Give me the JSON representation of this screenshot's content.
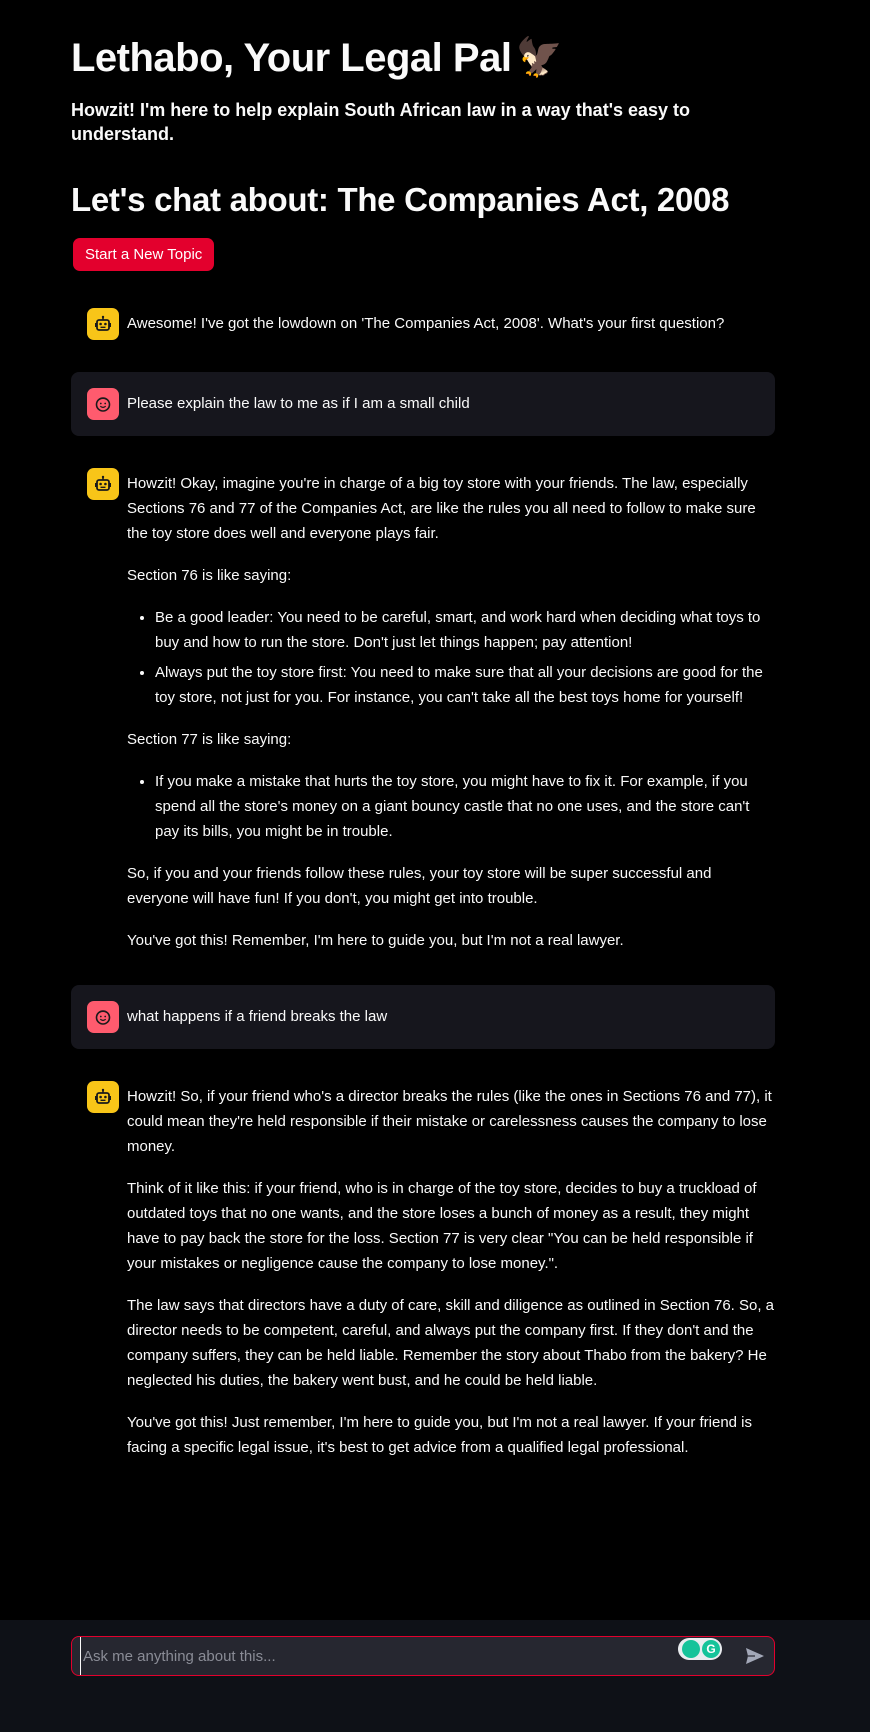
{
  "header": {
    "title": "Lethabo, Your Legal Pal",
    "title_emoji": "🦅",
    "subtitle": "Howzit! I'm here to help explain South African law in a way that's easy to understand.",
    "topic_heading": "Let's chat about: The Companies Act, 2008",
    "new_topic_label": "Start a New Topic"
  },
  "messages": {
    "m1": {
      "role": "assistant",
      "text": "Awesome! I've got the lowdown on 'The Companies Act, 2008'. What's your first question?"
    },
    "m2": {
      "role": "user",
      "text": "Please explain the law to me as if I am a small child"
    },
    "m3": {
      "role": "assistant",
      "p1": "Howzit! Okay, imagine you're in charge of a big toy store with your friends. The law, especially Sections 76 and 77 of the Companies Act, are like the rules you all need to follow to make sure the toy store does well and everyone plays fair.",
      "p2": "Section 76 is like saying:",
      "b1": "Be a good leader: You need to be careful, smart, and work hard when deciding what toys to buy and how to run the store. Don't just let things happen; pay attention!",
      "b2": "Always put the toy store first: You need to make sure that all your decisions are good for the toy store, not just for you. For instance, you can't take all the best toys home for yourself!",
      "p3": "Section 77 is like saying:",
      "b3": "If you make a mistake that hurts the toy store, you might have to fix it. For example, if you spend all the store's money on a giant bouncy castle that no one uses, and the store can't pay its bills, you might be in trouble.",
      "p4": "So, if you and your friends follow these rules, your toy store will be super successful and everyone will have fun! If you don't, you might get into trouble.",
      "p5": "You've got this! Remember, I'm here to guide you, but I'm not a real lawyer."
    },
    "m4": {
      "role": "user",
      "text": "what happens if a friend breaks the law"
    },
    "m5": {
      "role": "assistant",
      "p1": "Howzit! So, if your friend who's a director breaks the rules (like the ones in Sections 76 and 77), it could mean they're held responsible if their mistake or carelessness causes the company to lose money.",
      "p2": "Think of it like this: if your friend, who is in charge of the toy store, decides to buy a truckload of outdated toys that no one wants, and the store loses a bunch of money as a result, they might have to pay back the store for the loss. Section 77 is very clear \"You can be held responsible if your mistakes or negligence cause the company to lose money.\".",
      "p3": "The law says that directors have a duty of care, skill and diligence as outlined in Section 76. So, a director needs to be competent, careful, and always put the company first. If they don't and the company suffers, they can be held liable. Remember the story about Thabo from the bakery? He neglected his duties, the bakery went bust, and he could be held liable.",
      "p4": "You've got this! Just remember, I'm here to guide you, but I'm not a real lawyer. If your friend is facing a specific legal issue, it's best to get advice from a qualified legal professional."
    }
  },
  "chat_input": {
    "placeholder": "Ask me anything about this...",
    "value": ""
  },
  "icons": {
    "assistant_avatar": "robot-icon",
    "user_avatar": "smiley-face-icon",
    "send": "send-arrow-icon",
    "extension": "grammarly-icon"
  },
  "colors": {
    "accent": "#e3002d",
    "assistant_avatar": "#f8c518",
    "user_avatar": "#ff5b6e",
    "user_bubble": "#16161d",
    "input_bg": "#262730"
  }
}
